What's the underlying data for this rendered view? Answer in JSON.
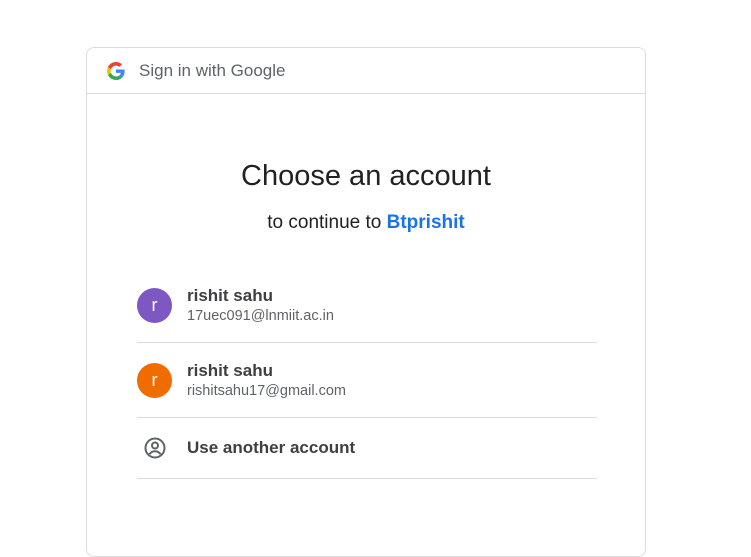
{
  "header": {
    "text": "Sign in with Google",
    "logo_icon": "google-g-icon"
  },
  "main": {
    "title": "Choose an account",
    "subtitle_prefix": "to continue to ",
    "app_name": "Btprishit"
  },
  "accounts": [
    {
      "name": "rishit sahu",
      "email": "17uec091@lnmiit.ac.in",
      "initial": "r",
      "avatar_color": "#7e57c2"
    },
    {
      "name": "rishit sahu",
      "email": "rishitsahu17@gmail.com",
      "initial": "r",
      "avatar_color": "#ef6c00"
    }
  ],
  "other_account": {
    "label": "Use another account",
    "icon": "person-circle-icon"
  },
  "colors": {
    "link": "#1a73e8",
    "divider": "#dadce0",
    "secondary_text": "#5f6368"
  }
}
